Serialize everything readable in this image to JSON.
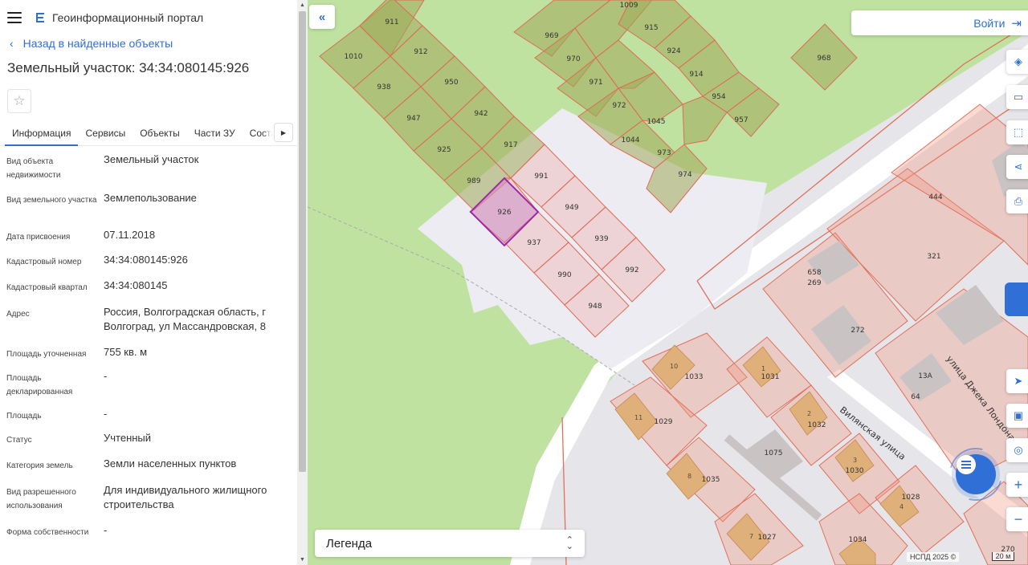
{
  "header": {
    "app_title": "Геоинформационный портал"
  },
  "nav": {
    "back_label": "Назад в найденные объекты"
  },
  "object": {
    "title": "Земельный участок: 34:34:080145:926"
  },
  "tabs": [
    {
      "label": "Информация"
    },
    {
      "label": "Сервисы"
    },
    {
      "label": "Объекты"
    },
    {
      "label": "Части ЗУ"
    },
    {
      "label": "Соста"
    }
  ],
  "properties": [
    {
      "label": "Вид объекта недвижимости",
      "value": "Земельный участок"
    },
    {
      "label": "Вид земельного участка",
      "value": "Землепользование"
    },
    {
      "label": "Дата присвоения",
      "value": "07.11.2018"
    },
    {
      "label": "Кадастровый номер",
      "value": "34:34:080145:926"
    },
    {
      "label": "Кадастровый квартал",
      "value": "34:34:080145"
    },
    {
      "label": "Адрес",
      "value": "Россия, Волгоградская область, г Волгоград, ул Массандровская, 8"
    },
    {
      "label": "Площадь уточненная",
      "value": "755 кв. м"
    },
    {
      "label": "Площадь декларированная",
      "value": "-"
    },
    {
      "label": "Площадь",
      "value": "-"
    },
    {
      "label": "Статус",
      "value": "Учтенный"
    },
    {
      "label": "Категория земель",
      "value": "Земли населенных пунктов"
    },
    {
      "label": "Вид разрешенного использования",
      "value": "Для индивидуального жилищного строительства"
    },
    {
      "label": "Форма собственности",
      "value": "-"
    }
  ],
  "map": {
    "login_label": "Войти",
    "legend_label": "Легенда",
    "attribution": "НСПД 2025 ©",
    "scale_label": "20 м",
    "streets": [
      "Вилянская улица",
      "улица Джека Лондона"
    ],
    "plots": [
      {
        "n": "1009",
        "c": [
          783,
          6
        ]
      },
      {
        "n": "911",
        "c": [
          488,
          27
        ]
      },
      {
        "n": "969",
        "c": [
          687,
          44
        ]
      },
      {
        "n": "915",
        "c": [
          811,
          34
        ]
      },
      {
        "n": "1010",
        "c": [
          440,
          70
        ]
      },
      {
        "n": "912",
        "c": [
          524,
          64
        ]
      },
      {
        "n": "970",
        "c": [
          714,
          73
        ]
      },
      {
        "n": "924",
        "c": [
          839,
          63
        ]
      },
      {
        "n": "968",
        "c": [
          1026,
          72
        ]
      },
      {
        "n": "938",
        "c": [
          478,
          108
        ]
      },
      {
        "n": "950",
        "c": [
          562,
          102
        ]
      },
      {
        "n": "971",
        "c": [
          742,
          102
        ]
      },
      {
        "n": "914",
        "c": [
          867,
          92
        ]
      },
      {
        "n": "947",
        "c": [
          515,
          147
        ]
      },
      {
        "n": "942",
        "c": [
          599,
          141
        ]
      },
      {
        "n": "972",
        "c": [
          771,
          131
        ]
      },
      {
        "n": "954",
        "c": [
          895,
          120
        ]
      },
      {
        "n": "1045",
        "c": [
          817,
          151
        ]
      },
      {
        "n": "957",
        "c": [
          923,
          149
        ]
      },
      {
        "n": "925",
        "c": [
          553,
          186
        ]
      },
      {
        "n": "917",
        "c": [
          636,
          180
        ]
      },
      {
        "n": "1044",
        "c": [
          785,
          174
        ]
      },
      {
        "n": "973",
        "c": [
          827,
          190
        ]
      },
      {
        "n": "974",
        "c": [
          853,
          217
        ]
      },
      {
        "n": "989",
        "c": [
          590,
          225
        ]
      },
      {
        "n": "991",
        "c": [
          674,
          219
        ]
      },
      {
        "n": "949",
        "c": [
          712,
          258
        ]
      },
      {
        "n": "939",
        "c": [
          749,
          297
        ]
      },
      {
        "n": "937",
        "c": [
          665,
          302
        ]
      },
      {
        "n": "990",
        "c": [
          703,
          342
        ]
      },
      {
        "n": "992",
        "c": [
          787,
          336
        ]
      },
      {
        "n": "948",
        "c": [
          741,
          381
        ]
      },
      {
        "n": "444",
        "c": [
          1165,
          245
        ]
      },
      {
        "n": "321",
        "c": [
          1163,
          319
        ]
      },
      {
        "n": "658",
        "c": [
          1014,
          339
        ]
      },
      {
        "n": "269",
        "c": [
          1014,
          352
        ]
      },
      {
        "n": "272",
        "c": [
          1068,
          411
        ]
      },
      {
        "n": "13А",
        "c": [
          1152,
          468
        ]
      },
      {
        "n": "64",
        "c": [
          1140,
          494
        ]
      },
      {
        "n": "1033",
        "c": [
          864,
          469
        ]
      },
      {
        "n": "1031",
        "c": [
          959,
          469
        ]
      },
      {
        "n": "1029",
        "c": [
          826,
          525
        ]
      },
      {
        "n": "1032",
        "c": [
          1017,
          529
        ]
      },
      {
        "n": "1075",
        "c": [
          963,
          564
        ]
      },
      {
        "n": "1030",
        "c": [
          1064,
          586
        ]
      },
      {
        "n": "1035",
        "c": [
          885,
          597
        ]
      },
      {
        "n": "1028",
        "c": [
          1134,
          619
        ]
      },
      {
        "n": "1027",
        "c": [
          955,
          669
        ]
      },
      {
        "n": "1034",
        "c": [
          1068,
          672
        ]
      },
      {
        "n": "270",
        "c": [
          1255,
          684
        ]
      }
    ],
    "selected_plot": {
      "n": "926",
      "c": [
        628,
        264
      ]
    },
    "buildings": [
      {
        "n": "10",
        "c": [
          834,
          456
        ]
      },
      {
        "n": "1",
        "c": [
          948,
          459
        ]
      },
      {
        "n": "11",
        "c": [
          790,
          520
        ]
      },
      {
        "n": "2",
        "c": [
          1005,
          515
        ]
      },
      {
        "n": "3",
        "c": [
          1062,
          573
        ]
      },
      {
        "n": "8",
        "c": [
          856,
          593
        ]
      },
      {
        "n": "4",
        "c": [
          1120,
          631
        ]
      },
      {
        "n": "7",
        "c": [
          933,
          668
        ]
      }
    ]
  }
}
